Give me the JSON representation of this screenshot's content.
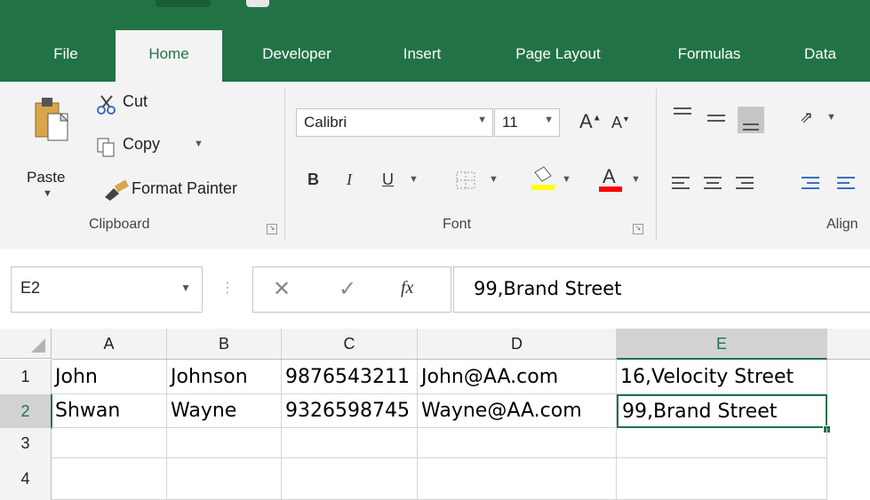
{
  "tabs": [
    "File",
    "Home",
    "Developer",
    "Insert",
    "Page Layout",
    "Formulas",
    "Data"
  ],
  "active_tab": "Home",
  "clipboard": {
    "paste": "Paste",
    "cut": "Cut",
    "copy": "Copy",
    "format_painter": "Format Painter",
    "group_label": "Clipboard"
  },
  "font": {
    "name": "Calibri",
    "size": "11",
    "bold": "B",
    "italic": "I",
    "underline": "U",
    "font_color_glyph": "A",
    "group_label": "Font",
    "fill_color": "#ffff00",
    "text_color": "#ff0000"
  },
  "alignment": {
    "group_label": "Align"
  },
  "formula_bar": {
    "name_box": "E2",
    "fx": "fx",
    "value": "99,Brand Street"
  },
  "columns": [
    "A",
    "B",
    "C",
    "D",
    "E"
  ],
  "selected_column": "E",
  "rows": [
    {
      "num": "1",
      "cells": [
        "John",
        "Johnson",
        "9876543211",
        "John@AA.com",
        "16,Velocity Street"
      ]
    },
    {
      "num": "2",
      "cells": [
        "Shwan",
        "Wayne",
        "9326598745",
        "Wayne@AA.com",
        "99,Brand Street"
      ]
    },
    {
      "num": "3",
      "cells": [
        "",
        "",
        "",
        "",
        ""
      ]
    },
    {
      "num": "4",
      "cells": [
        "",
        "",
        "",
        "",
        ""
      ]
    }
  ],
  "selected_cell": "E2",
  "accent_color": "#217346"
}
